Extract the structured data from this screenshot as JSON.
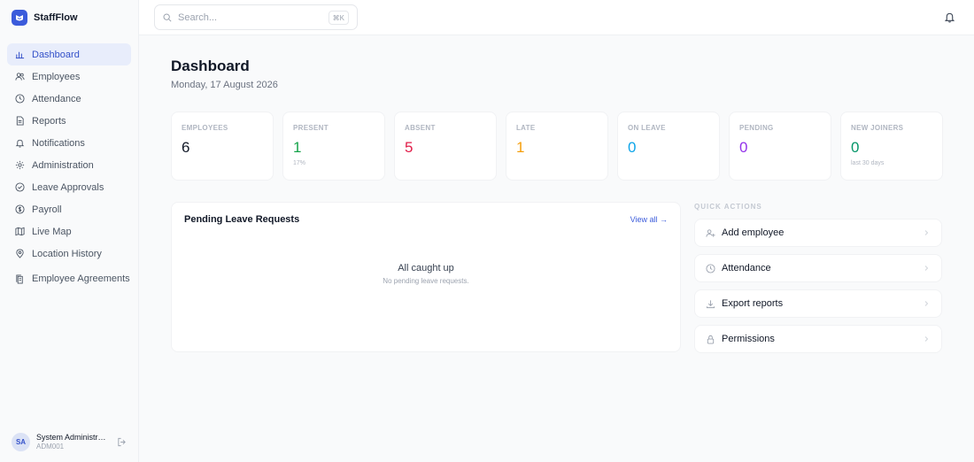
{
  "app": {
    "name": "StaffFlow",
    "logo_icon": "staffflow-logo-icon"
  },
  "sidebar": {
    "items": [
      {
        "label": "Dashboard",
        "icon": "bar-chart-icon",
        "active": true
      },
      {
        "label": "Employees",
        "icon": "users-icon"
      },
      {
        "label": "Attendance",
        "icon": "clock-icon"
      },
      {
        "label": "Reports",
        "icon": "file-icon"
      },
      {
        "label": "Notifications",
        "icon": "bell-icon"
      },
      {
        "label": "Administration",
        "icon": "gear-icon"
      },
      {
        "label": "Leave Approvals",
        "icon": "check-circle-icon"
      },
      {
        "label": "Payroll",
        "icon": "dollar-circle-icon"
      },
      {
        "label": "Live Map",
        "icon": "map-icon"
      },
      {
        "label": "Location History",
        "icon": "map-pin-icon"
      },
      {
        "label": "Employee Agreements",
        "icon": "documents-icon"
      }
    ]
  },
  "user": {
    "initials": "SA",
    "name": "System Administrator",
    "id": "ADM001"
  },
  "search": {
    "placeholder": "Search...",
    "shortcut": "⌘K"
  },
  "header": {
    "title": "Dashboard",
    "date": "Monday, 17 August 2026"
  },
  "stats": [
    {
      "label": "EMPLOYEES",
      "value": "6",
      "sub": "",
      "color": "#111827"
    },
    {
      "label": "PRESENT",
      "value": "1",
      "sub": "17%",
      "color": "#16a34a"
    },
    {
      "label": "ABSENT",
      "value": "5",
      "sub": "",
      "color": "#e11d48"
    },
    {
      "label": "LATE",
      "value": "1",
      "sub": "",
      "color": "#f59e0b"
    },
    {
      "label": "ON LEAVE",
      "value": "0",
      "sub": "",
      "color": "#0ea5e9"
    },
    {
      "label": "PENDING",
      "value": "0",
      "sub": "",
      "color": "#9333ea"
    },
    {
      "label": "NEW JOINERS",
      "value": "0",
      "sub": "last 30 days",
      "color": "#059669"
    }
  ],
  "pending": {
    "title": "Pending Leave Requests",
    "link": "View all →",
    "empty_title": "All caught up",
    "empty_sub": "No pending leave requests."
  },
  "quick_actions": {
    "label": "QUICK ACTIONS",
    "items": [
      {
        "label": "Add employee",
        "icon": "user-plus-icon"
      },
      {
        "label": "Attendance",
        "icon": "clock-icon"
      },
      {
        "label": "Export reports",
        "icon": "download-icon"
      },
      {
        "label": "Permissions",
        "icon": "lock-icon"
      }
    ]
  }
}
